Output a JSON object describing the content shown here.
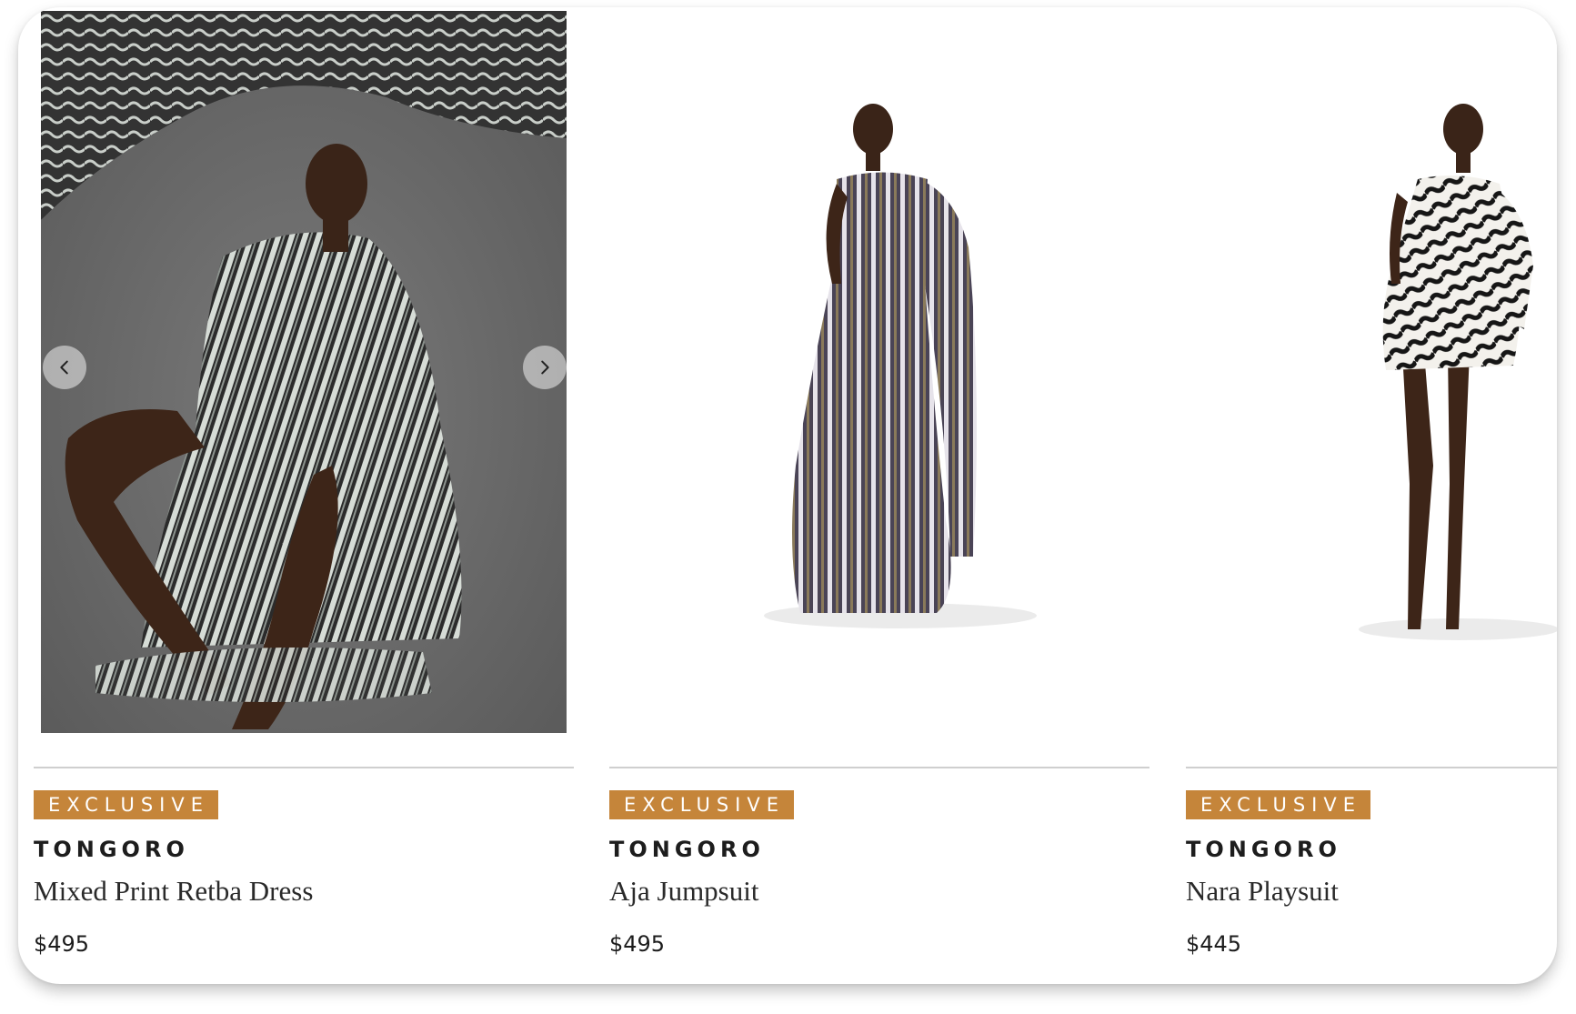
{
  "products": [
    {
      "badge": "EXCLUSIVE",
      "brand": "TONGORO",
      "name": "Mixed Print Retba Dress",
      "price": "$495",
      "image": "Model seated in oversized black-and-white striped kaftan dress against grey backdrop with patterned fabric overhead",
      "carousel": {
        "prev_icon": "chevron-left-icon",
        "next_icon": "chevron-right-icon"
      }
    },
    {
      "badge": "EXCLUSIVE",
      "brand": "TONGORO",
      "name": "Aja Jumpsuit",
      "price": "$495",
      "image": "Model standing in one-shoulder wide-leg striped jumpsuit with draped sleeve on white background"
    },
    {
      "badge": "EXCLUSIVE",
      "brand": "TONGORO",
      "name": "Nara Playsuit",
      "price": "$445",
      "image": "Model standing in zebra print one-shoulder playsuit with heeled sandals on white background"
    }
  ],
  "colors": {
    "badge_bg": "#c5853a",
    "badge_text": "#ffffff",
    "studio_bg": "#6d6d6d",
    "divider": "#cfcfcf"
  }
}
